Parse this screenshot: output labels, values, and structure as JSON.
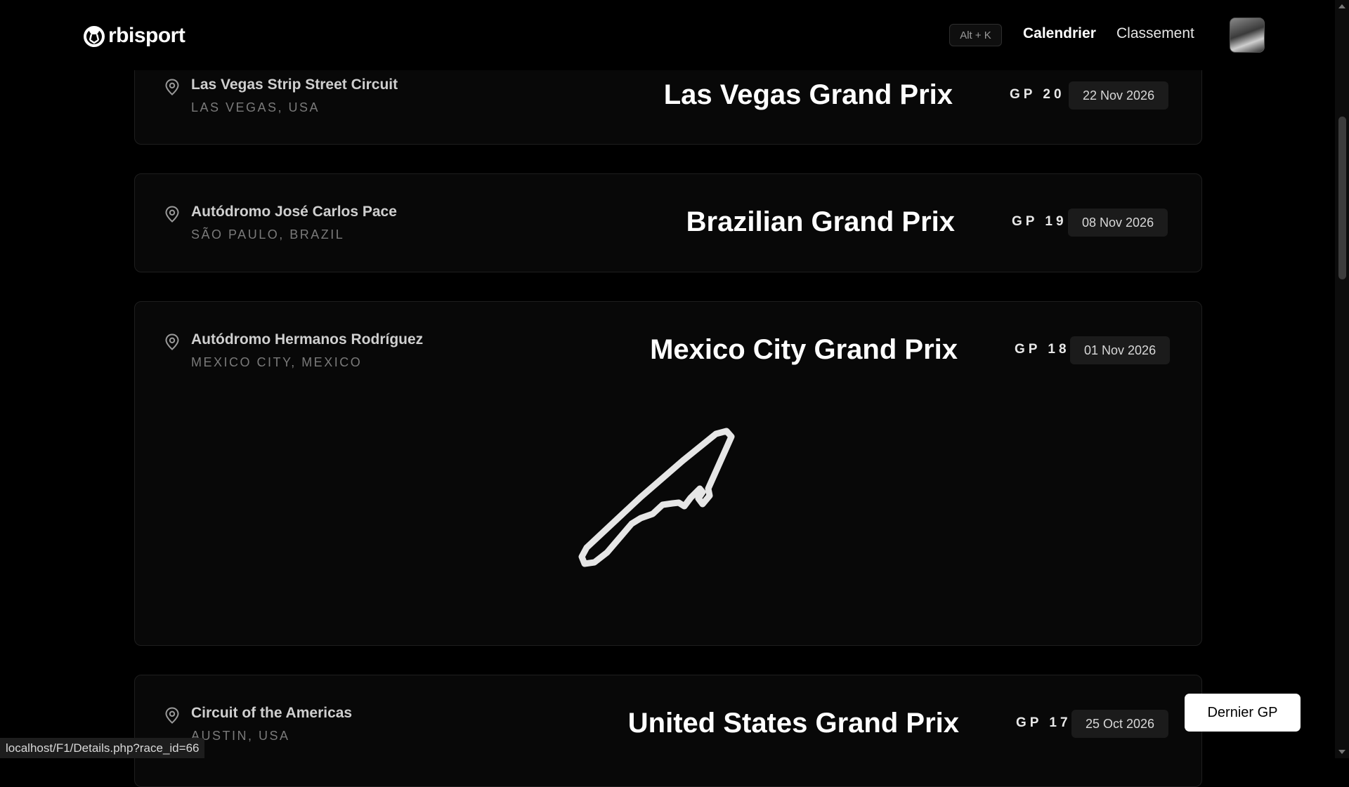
{
  "app": {
    "logo_text": "rbisport",
    "logo_icon": "orbisport-o-mark"
  },
  "nav": {
    "shortcut": "Alt + K",
    "links": [
      {
        "label": "Calendrier",
        "active": true
      },
      {
        "label": "Classement",
        "active": false
      }
    ],
    "avatar": "user-avatar-photo"
  },
  "races": [
    {
      "circuit": "Las Vegas Strip Street Circuit",
      "location": "LAS VEGAS, USA",
      "title": "Las Vegas Grand Prix",
      "round": "GP 20",
      "date": "22 Nov 2026"
    },
    {
      "circuit": "Autódromo José Carlos Pace",
      "location": "SÃO PAULO, BRAZIL",
      "title": "Brazilian Grand Prix",
      "round": "GP 19",
      "date": "08 Nov 2026"
    },
    {
      "circuit": "Autódromo Hermanos Rodríguez",
      "location": "MEXICO CITY, MEXICO",
      "title": "Mexico City Grand Prix",
      "round": "GP 18",
      "date": "01 Nov 2026",
      "track_map": "mexico-city-track-outline"
    },
    {
      "circuit": "Circuit of the Americas",
      "location": "AUSTIN, USA",
      "title": "United States Grand Prix",
      "round": "GP 17",
      "date": "25 Oct 2026"
    }
  ],
  "floating_button": "Dernier GP",
  "status_url": "localhost/F1/Details.php?race_id=66",
  "colors": {
    "background": "#000000",
    "card": "#080808",
    "accent_button": "#ffffff"
  }
}
